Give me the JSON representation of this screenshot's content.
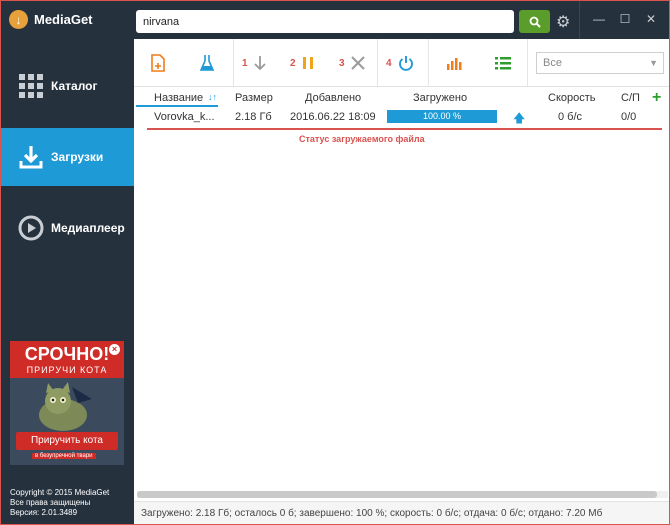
{
  "app": {
    "name": "MediaGet",
    "logo_glyph": "↓"
  },
  "search": {
    "value": "nirvana"
  },
  "colors": {
    "accent": "#1e9ad6",
    "sidebar": "#25313d",
    "red": "#d9534f",
    "search_btn": "#5a9d2a"
  },
  "sidebar": {
    "items": [
      {
        "label": "Каталог",
        "icon": "grid-icon",
        "active": false
      },
      {
        "label": "Загрузки",
        "icon": "download-icon",
        "active": true
      },
      {
        "label": "Медиаплеер",
        "icon": "play-icon",
        "active": false
      }
    ],
    "ad": {
      "title": "СРОЧНО!",
      "subtitle": "ПРИРУЧИ КОТА",
      "button": "Приручить кота",
      "small": "в безупречной твари"
    },
    "copyright": [
      "Copyright © 2015 MediaGet",
      "Все права защищены",
      "Версия: 2.01.3489"
    ]
  },
  "toolbar": {
    "numbers": [
      "1",
      "2",
      "3",
      "4"
    ],
    "filter": {
      "value": "Все"
    }
  },
  "table": {
    "columns": [
      "Название",
      "Размер",
      "Добавлено",
      "Загружено",
      "Скорость",
      "С/П"
    ],
    "rows": [
      {
        "name": "Vorovka_k...",
        "size": "2.18 Гб",
        "added": "2016.06.22 18:09",
        "progress": "100.00 %",
        "speed": "0 б/с",
        "sp": "0/0"
      }
    ]
  },
  "annotation": "Статус загружаемого файла",
  "statusbar": "Загружено: 2.18 Гб; осталось 0 б; завершено: 100 %; скорость: 0 б/с; отдача: 0 б/с; отдано: 7.20 Мб"
}
